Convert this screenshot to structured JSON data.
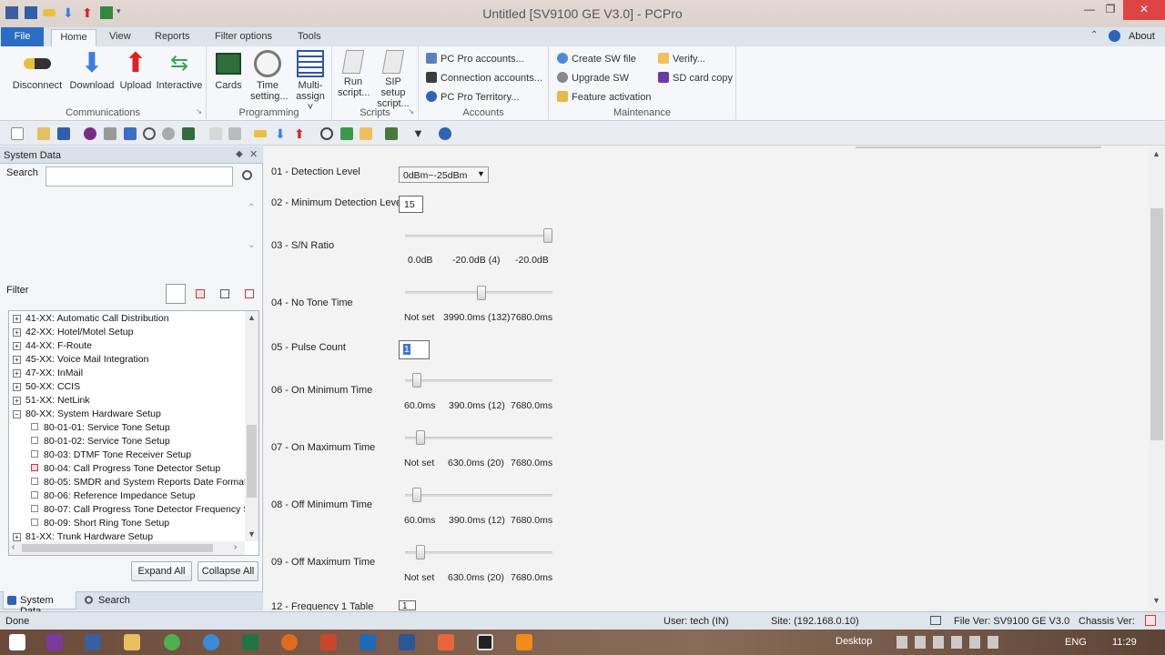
{
  "window": {
    "title": "Untitled [SV9100 GE V3.0] - PCPro",
    "minimize": "—",
    "restore": "❐",
    "close": "✕"
  },
  "ribbon_tabs": [
    "File",
    "Home",
    "View",
    "Reports",
    "Filter options",
    "Tools"
  ],
  "about": "About",
  "ribbon": {
    "communications": {
      "label": "Communications",
      "buttons": [
        "Disconnect",
        "Download",
        "Upload",
        "Interactive"
      ]
    },
    "programming": {
      "label": "Programming",
      "buttons": [
        "Cards",
        "Time setting...",
        "Multi-assign ˅"
      ]
    },
    "scripts": {
      "label": "Scripts",
      "buttons": [
        "Run script...",
        "SIP setup script..."
      ]
    },
    "accounts": {
      "label": "Accounts",
      "items": [
        "PC Pro accounts...",
        "Connection accounts...",
        "PC Pro Territory..."
      ]
    },
    "maintenance": {
      "label": "Maintenance",
      "items_left": [
        "Create SW file",
        "Upgrade SW",
        "Feature activation"
      ],
      "items_right": [
        "Verify...",
        "SD card copy"
      ]
    }
  },
  "left_panel": {
    "title": "System Data",
    "search_label": "Search",
    "search_value": "",
    "filter_label": "Filter",
    "tree": [
      {
        "text": "41-XX: Automatic Call Distribution",
        "type": "plus"
      },
      {
        "text": "42-XX: Hotel/Motel Setup",
        "type": "plus"
      },
      {
        "text": "44-XX: F-Route",
        "type": "plus"
      },
      {
        "text": "45-XX: Voice Mail Integration",
        "type": "plus"
      },
      {
        "text": "47-XX: InMail",
        "type": "plus"
      },
      {
        "text": "50-XX: CCIS",
        "type": "plus"
      },
      {
        "text": "51-XX: NetLink",
        "type": "plus"
      },
      {
        "text": "80-XX: System Hardware Setup",
        "type": "minus"
      },
      {
        "text": "80-01-01: Service Tone Setup",
        "type": "leaf"
      },
      {
        "text": "80-01-02: Service Tone Setup",
        "type": "leaf"
      },
      {
        "text": "80-03: DTMF Tone Receiver Setup",
        "type": "leaf"
      },
      {
        "text": "80-04: Call Progress Tone Detector Setup",
        "type": "leaf-red"
      },
      {
        "text": "80-05: SMDR and System Reports Date Format",
        "type": "leaf"
      },
      {
        "text": "80-06: Reference Impedance Setup",
        "type": "leaf"
      },
      {
        "text": "80-07: Call Progress Tone Detector Frequency S",
        "type": "leaf"
      },
      {
        "text": "80-09: Short Ring Tone Setup",
        "type": "leaf"
      },
      {
        "text": "81-XX: Trunk Hardware Setup",
        "type": "plus"
      }
    ],
    "expand_all": "Expand All",
    "collapse_all": "Collapse All",
    "bottom_tabs": [
      "System Data",
      "Search"
    ]
  },
  "settings": {
    "detection_level": {
      "label": "01 - Detection Level",
      "value": "0dBm~-25dBm"
    },
    "min_detection_level": {
      "label": "02 - Minimum Detection Level",
      "value": "15"
    },
    "sn_ratio": {
      "label": "03 - S/N Ratio",
      "min": "0.0dB",
      "current": "-20.0dB (4)",
      "max": "-20.0dB",
      "position": 1.0
    },
    "no_tone_time": {
      "label": "04 - No Tone Time",
      "min": "Not set",
      "current": "3990.0ms (132)",
      "max": "7680.0ms",
      "position": 0.52
    },
    "pulse_count": {
      "label": "05 - Pulse Count",
      "value": "1"
    },
    "on_min_time": {
      "label": "06 - On Minimum Time",
      "min": "60.0ms",
      "current": "390.0ms (12)",
      "max": "7680.0ms",
      "position": 0.05
    },
    "on_max_time": {
      "label": "07 - On Maximum Time",
      "min": "Not set",
      "current": "630.0ms (20)",
      "max": "7680.0ms",
      "position": 0.08
    },
    "off_min_time": {
      "label": "08 - Off Minimum Time",
      "min": "60.0ms",
      "current": "390.0ms (12)",
      "max": "7680.0ms",
      "position": 0.05
    },
    "off_max_time": {
      "label": "09 - Off Maximum Time",
      "min": "Not set",
      "current": "630.0ms (20)",
      "max": "7680.0ms",
      "position": 0.08
    },
    "freq_table": {
      "label": "12 - Frequency 1 Table",
      "value": "1"
    }
  },
  "status_bar": {
    "status": "Done",
    "user": "User: tech (IN)",
    "site": "Site:  (192.168.0.10)",
    "file_ver": "File Ver: SV9100 GE V3.0",
    "chassis_ver": "Chassis Ver:"
  },
  "taskbar": {
    "desktop": "Desktop",
    "lang": "ENG",
    "time": "11:29"
  }
}
